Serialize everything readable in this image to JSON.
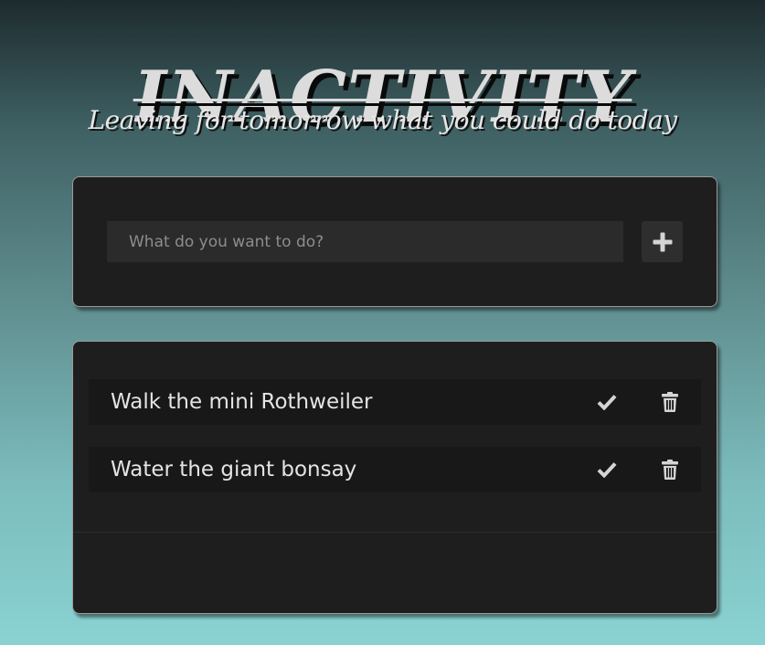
{
  "header": {
    "title": "INACTIVITY",
    "subtitle": "Leaving for tomorrow what you could do today"
  },
  "form": {
    "input_placeholder": "What do you want to do?",
    "input_value": "",
    "add_button_icon": "plus-icon"
  },
  "todos": [
    {
      "text": "Walk the mini Rothweiler",
      "complete_icon": "check-icon",
      "delete_icon": "trash-icon"
    },
    {
      "text": "Water the giant bonsay",
      "complete_icon": "check-icon",
      "delete_icon": "trash-icon"
    }
  ],
  "colors": {
    "card_background": "#1e1e1e",
    "item_background": "#181818",
    "input_background": "#2b2b2b",
    "icon_color": "#d4d4d4",
    "gradient_top": "#1d2b2e",
    "gradient_bottom": "#8ad2d2"
  }
}
